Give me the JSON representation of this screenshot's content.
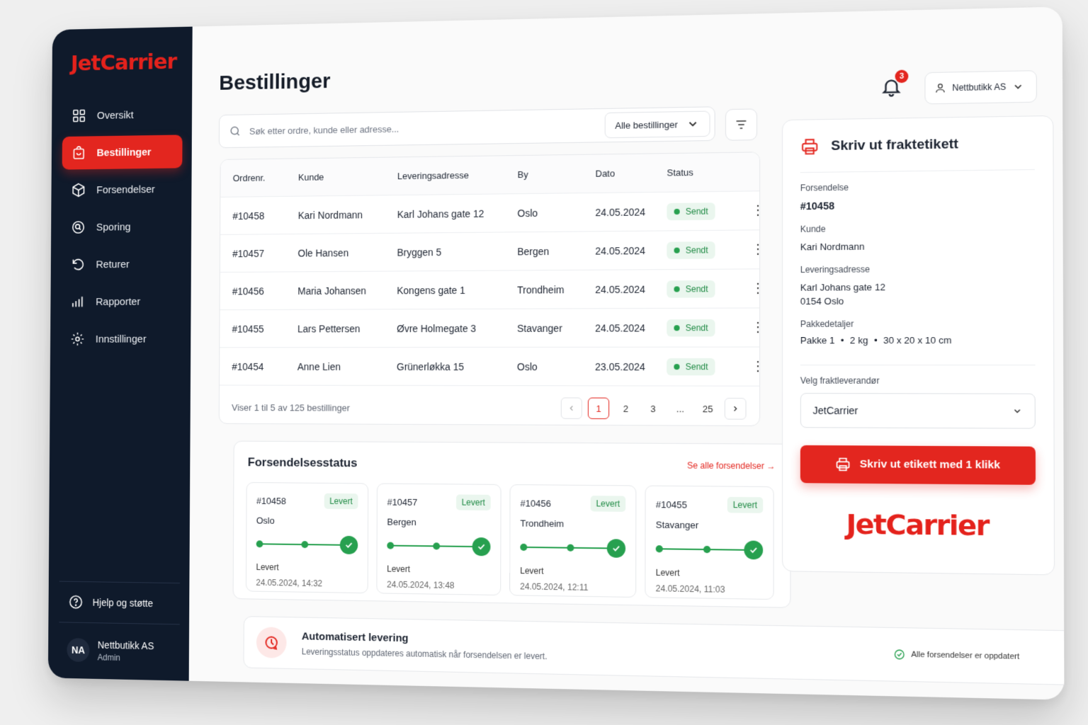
{
  "brand": {
    "name": "JetCarrier",
    "accent": "#e3261f",
    "sidebar_bg": "#0f1a2b"
  },
  "sidebar": {
    "items": [
      {
        "label": "Oversikt",
        "icon": "grid-icon"
      },
      {
        "label": "Bestillinger",
        "icon": "bag-icon",
        "active": true
      },
      {
        "label": "Forsendelser",
        "icon": "box-icon"
      },
      {
        "label": "Sporing",
        "icon": "search-icon"
      },
      {
        "label": "Returer",
        "icon": "return-icon"
      },
      {
        "label": "Rapporter",
        "icon": "bar-chart-icon"
      },
      {
        "label": "Innstillinger",
        "icon": "gear-icon"
      }
    ],
    "help_label": "Hjelp og støtte",
    "user": {
      "initials": "NA",
      "name": "Nettbutikk AS",
      "role": "Admin"
    }
  },
  "header": {
    "title": "Bestillinger",
    "notification_count": "3",
    "account_label": "Nettbutikk AS"
  },
  "search": {
    "placeholder": "Søk etter ordre, kunde eller adresse...",
    "filter_select": "Alle bestillinger"
  },
  "orders": {
    "columns": [
      "Ordrenr.",
      "Kunde",
      "Leveringsadresse",
      "By",
      "Dato",
      "Status"
    ],
    "rows": [
      {
        "id": "#10458",
        "customer": "Kari Nordmann",
        "address": "Karl Johans gate 12",
        "city": "Oslo",
        "date": "24.05.2024",
        "status": "Sendt"
      },
      {
        "id": "#10457",
        "customer": "Ole Hansen",
        "address": "Bryggen 5",
        "city": "Bergen",
        "date": "24.05.2024",
        "status": "Sendt"
      },
      {
        "id": "#10456",
        "customer": "Maria Johansen",
        "address": "Kongens gate 1",
        "city": "Trondheim",
        "date": "24.05.2024",
        "status": "Sendt"
      },
      {
        "id": "#10455",
        "customer": "Lars Pettersen",
        "address": "Øvre Holmegate 3",
        "city": "Stavanger",
        "date": "24.05.2024",
        "status": "Sendt"
      },
      {
        "id": "#10454",
        "customer": "Anne Lien",
        "address": "Grünerløkka 15",
        "city": "Oslo",
        "date": "23.05.2024",
        "status": "Sendt"
      }
    ],
    "footer_info": "Viser 1 til 5 av 125 bestillinger",
    "pages": [
      "1",
      "2",
      "3",
      "...",
      "25"
    ],
    "current_page": "1"
  },
  "shipments": {
    "title": "Forsendelsesstatus",
    "link": "Se alle forsendelser",
    "cards": [
      {
        "id": "#10458",
        "badge": "Levert",
        "city": "Oslo",
        "status": "Levert",
        "time": "24.05.2024, 14:32"
      },
      {
        "id": "#10457",
        "badge": "Levert",
        "city": "Bergen",
        "status": "Levert",
        "time": "24.05.2024, 13:48"
      },
      {
        "id": "#10456",
        "badge": "Levert",
        "city": "Trondheim",
        "status": "Levert",
        "time": "24.05.2024, 12:11"
      },
      {
        "id": "#10455",
        "badge": "Levert",
        "city": "Stavanger",
        "status": "Levert",
        "time": "24.05.2024, 11:03"
      }
    ]
  },
  "automation": {
    "title": "Automatisert levering",
    "subtitle": "Leveringsstatus oppdateres automatisk når forsendelsen er levert.",
    "status": "Alle forsendelser er oppdatert"
  },
  "label_panel": {
    "title": "Skriv ut fraktetikett",
    "shipment_label": "Forsendelse",
    "shipment_value": "#10458",
    "customer_label": "Kunde",
    "customer_value": "Kari Nordmann",
    "address_label": "Leveringsadresse",
    "address_line1": "Karl Johans gate 12",
    "address_line2": "0154 Oslo",
    "package_label": "Pakkedetaljer",
    "package_count": "Pakke 1",
    "package_weight": "2 kg",
    "package_size": "30 x 20 x 10 cm",
    "carrier_label": "Velg fraktleverandør",
    "carrier_value": "JetCarrier",
    "print_button": "Skriv ut etikett med 1 klikk",
    "logo": "JetCarrier"
  }
}
